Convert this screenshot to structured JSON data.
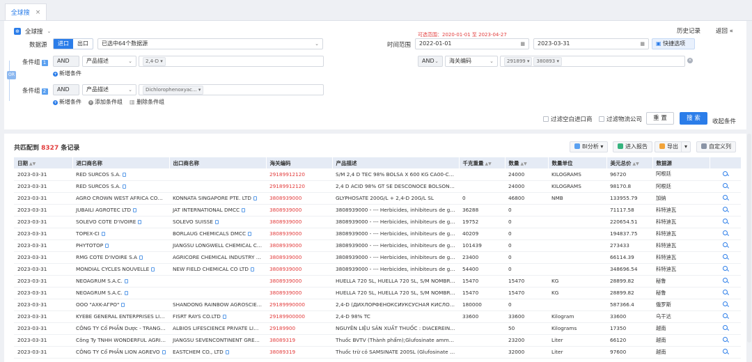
{
  "tab": {
    "label": "全球搜",
    "close": "×"
  },
  "header": {
    "scope_label": "全球搜",
    "history_label": "历史记录",
    "back_label": "返回",
    "back_arrow": "«"
  },
  "filters": {
    "datasource_label": "数据源",
    "import_label": "进口",
    "export_label": "出口",
    "datasource_value": "已选中64个数据源",
    "range_hint": "可选范围：2020-01-01 至 2023-04-27",
    "time_label": "时间范围",
    "date_start": "2022-01-01",
    "date_end": "2023-03-31",
    "quick_label": "快捷选项",
    "or_label": "OR",
    "group1_label": "条件组",
    "group1_num": "1",
    "group1_op": "AND",
    "group1_field": "产品描述",
    "group1_chip": "2,4-D",
    "add_condition_1": "新增条件",
    "right_op": "AND",
    "right_field": "海关编码",
    "right_chips": [
      "291899",
      "380893"
    ],
    "group2_label": "条件组",
    "group2_num": "2",
    "group2_op": "AND",
    "group2_field": "产品描述",
    "group2_chip": "Dichlorophenoxyac...",
    "add_condition_2": "新增条件",
    "add_group": "添加条件组",
    "delete_group": "删除条件组",
    "filter_empty": "过滤空白进口商",
    "filter_logistics": "过滤物流公司",
    "reset_label": "重 置",
    "search_label": "搜 索",
    "collapse_label": "收起条件"
  },
  "results": {
    "summary_prefix": "共匹配到",
    "count": "8327",
    "summary_suffix": "条记录",
    "bi_label": "BI分析",
    "report_label": "进入报告",
    "export_label": "导出",
    "custom_label": "自定义列",
    "columns": [
      "日期",
      "进口商名称",
      "出口商名称",
      "海关编码",
      "产品描述",
      "千克重量",
      "数量",
      "数量单位",
      "美元总价",
      "数据源"
    ],
    "rows": [
      [
        "2023-03-31",
        "RED SURCOS S.A.",
        "",
        "29189912120",
        "S/M 2,4 D TEC 98% BOLSA X 600 KG CA00-CE00-,2,4-D...",
        "",
        "24000",
        "KILOGRAMS",
        "96720",
        "阿根廷"
      ],
      [
        "2023-03-31",
        "RED SURCOS S.A.",
        "",
        "29189912120",
        "2,4 D ACID 98% GT SE DESCONOCE BOLSONES CA00-...",
        "",
        "24000",
        "KILOGRAMS",
        "98170.8",
        "阿根廷"
      ],
      [
        "2023-03-31",
        "AGRO CROWN WEST AFRICA COMP...",
        "KONNATA SINGAPORE PTE. LTD",
        "3808939000",
        "GLYPHOSATE 200G/L + 2,4-D 20G/L SL",
        "0",
        "46800",
        "NMB",
        "133955.79",
        "加纳"
      ],
      [
        "2023-03-31",
        "JUBAILI AGROTEC LTD",
        "JAT INTERNATIONAL DMCC",
        "3808939000",
        "3808939000 - --- Herbicides, inhibiteurs de germination ...",
        "36288",
        "0",
        "",
        "71117.58",
        "科特迪瓦"
      ],
      [
        "2023-03-31",
        "SOLEVO COTE D'IVOIRE",
        "SOLEVO SUISSE",
        "3808939000",
        "3808939000 - --- Herbicides, inhibiteurs de germination ...",
        "19752",
        "0",
        "",
        "220654.51",
        "科特迪瓦"
      ],
      [
        "2023-03-31",
        "TOPEX-CI",
        "BORLAUG CHEMICALS DMCC",
        "3808939000",
        "3808939000 - --- Herbicides, inhibiteurs de germination ...",
        "40209",
        "0",
        "",
        "194837.75",
        "科特迪瓦"
      ],
      [
        "2023-03-31",
        "PHYTOTOP",
        "JIANGSU LONGWELL CHEMICAL CO L...",
        "3808939000",
        "3808939000 - --- Herbicides, inhibiteurs de germination ...",
        "101439",
        "0",
        "",
        "273433",
        "科特迪瓦"
      ],
      [
        "2023-03-31",
        "RMG COTE D'IVOIRE S.A",
        "AGRICORE CHEMICAL INDUSTRY CO...",
        "3808939000",
        "3808939000 - --- Herbicides, inhibiteurs de germination ...",
        "23400",
        "0",
        "",
        "66114.39",
        "科特迪瓦"
      ],
      [
        "2023-03-31",
        "MONDIAL CYCLES NOUVELLE",
        "NEW FIELD CHEMICAL CO LTD",
        "3808939000",
        "3808939000 - --- Herbicides, inhibiteurs de germination ...",
        "54400",
        "0",
        "",
        "348696.54",
        "科特迪瓦"
      ],
      [
        "2023-03-31",
        "NEOAGRUM S.A.C.",
        "",
        "3808939000",
        "HUELLA 720 SL, HUELLA 720 SL, S/M NOMBRE COMERC...",
        "15470",
        "15470",
        "KG",
        "28899.82",
        "秘鲁"
      ],
      [
        "2023-03-31",
        "NEOAGRUM S.A.C.",
        "",
        "3808939000",
        "HUELLA 720 SL, HUELLA 720 SL, S/M NOMBRE COMERC...",
        "15470",
        "15470",
        "KG",
        "28899.82",
        "秘鲁"
      ],
      [
        "2023-03-31",
        "OOO \"AXK-AГPO\"",
        "SHANDONG RAINBOW AGROSCIENC...",
        "29189990000",
        "2,4-D (ДИХЛОРФЕНОКСИУКСУСНАЯ КИСЛОТА 98 %) ...",
        "180000",
        "0",
        "",
        "587366.4",
        "俄罗斯"
      ],
      [
        "2023-03-31",
        "KYEBE GENERAL ENTERPRISES LIMIT...",
        "FISRT RAYS CO.LTD",
        "29189900000",
        "2,4-D 98% TC",
        "33600",
        "33600",
        "Kilogram",
        "33600",
        "乌干达"
      ],
      [
        "2023-03-31",
        "CÔNG TY Cổ PHẦN Dược - TRANG TH...",
        "ALBIOS LIFESCIENCE PRIVATE LIMIT...",
        "29189900",
        "NGUYÊN LIỆU SẢN XUẤT THUỐC : DIACEREIN EP10. BA...",
        "",
        "50",
        "Kilograms",
        "17350",
        "越南"
      ],
      [
        "2023-03-31",
        "Công Ty TNHH WONDERFUL AGRICU...",
        "JIANGSU SEVENCONTINENT GREEN ...",
        "38089319",
        "Thuốc BVTV (Thành phẩm);Glufosinate ammonium 200 g...",
        "",
        "23200",
        "Liter",
        "66120",
        "越南"
      ],
      [
        "2023-03-31",
        "CÔNG TY Cổ PHẦN LION AGREVO",
        "EASTCHEM CO., LTD",
        "38089319",
        "Thuốc trừ cỏ SAMSINATE 200SL (Glufosinate Ammonium ...",
        "",
        "32000",
        "Liter",
        "97600",
        "越南"
      ]
    ]
  }
}
